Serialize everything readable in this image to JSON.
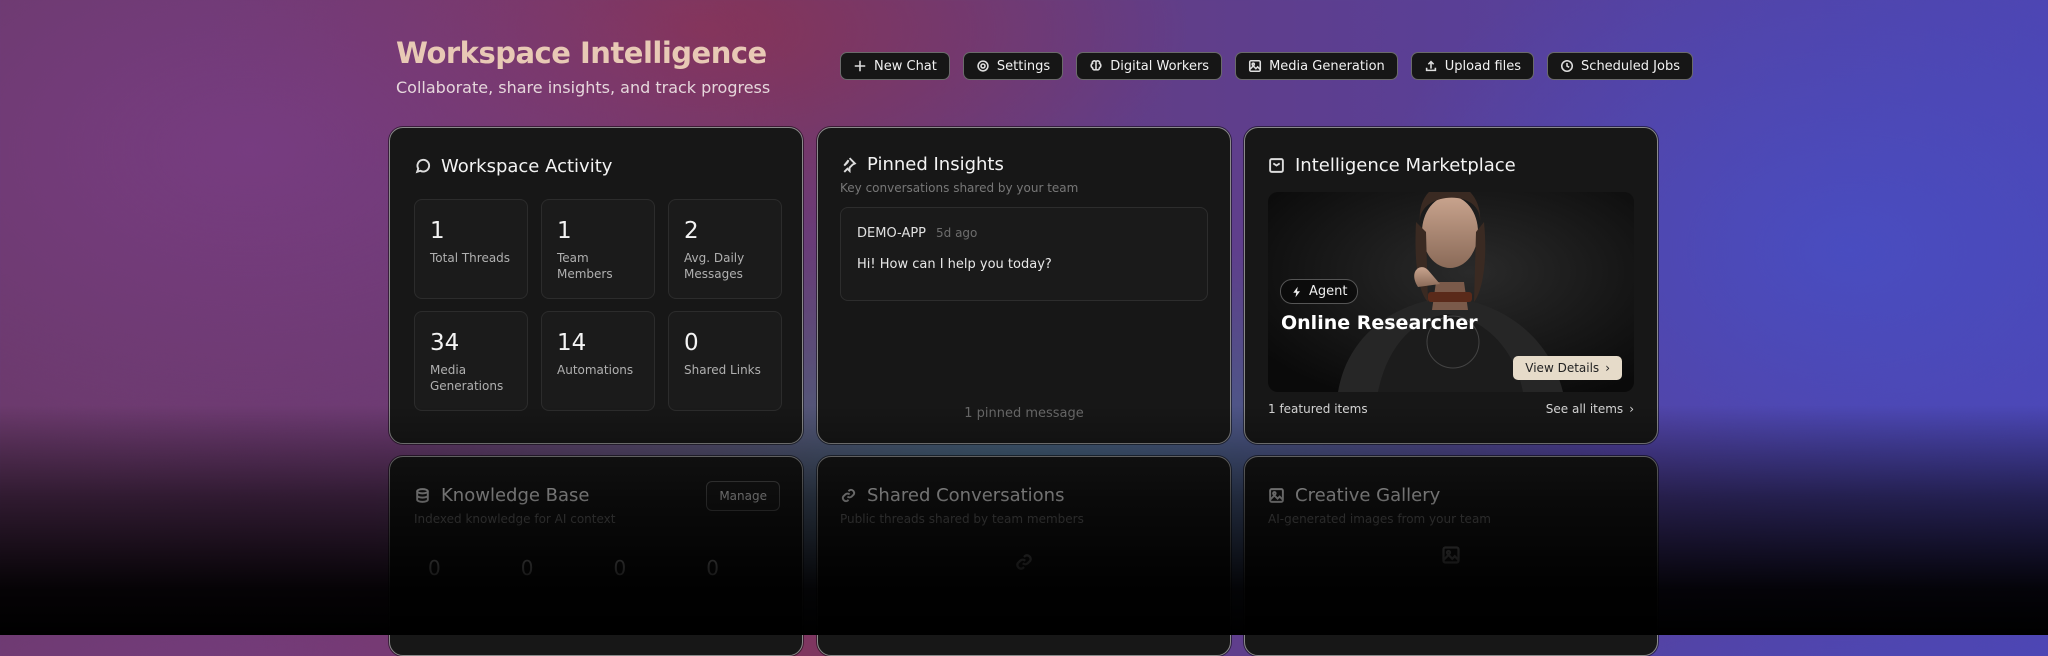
{
  "header": {
    "title": "Workspace Intelligence",
    "subtitle": "Collaborate, share insights, and track progress"
  },
  "toolbar": [
    {
      "label": "New Chat",
      "icon": "plus-icon"
    },
    {
      "label": "Settings",
      "icon": "gear-icon"
    },
    {
      "label": "Digital Workers",
      "icon": "brain-icon"
    },
    {
      "label": "Media Generation",
      "icon": "image-icon"
    },
    {
      "label": "Upload files",
      "icon": "upload-icon"
    },
    {
      "label": "Scheduled Jobs",
      "icon": "clock-icon"
    }
  ],
  "activity": {
    "title": "Workspace Activity",
    "stats": [
      {
        "value": "1",
        "label": "Total Threads"
      },
      {
        "value": "1",
        "label": "Team Members"
      },
      {
        "value": "2",
        "label": "Avg. Daily Messages"
      },
      {
        "value": "34",
        "label": "Media Generations"
      },
      {
        "value": "14",
        "label": "Automations"
      },
      {
        "value": "0",
        "label": "Shared Links"
      }
    ]
  },
  "pinned": {
    "title": "Pinned Insights",
    "subtitle": "Key conversations shared by your team",
    "item": {
      "app": "DEMO-APP",
      "time": "5d ago",
      "message": "Hi! How can I help you today?"
    },
    "footer": "1 pinned message"
  },
  "marketplace": {
    "title": "Intelligence Marketplace",
    "badge": "Agent",
    "agent_name": "Online Researcher",
    "view_details": "View Details",
    "featured": "1 featured items",
    "see_all": "See all items"
  },
  "knowledge": {
    "title": "Knowledge Base",
    "subtitle": "Indexed knowledge for AI context",
    "manage": "Manage",
    "values": [
      "0",
      "0",
      "0",
      "0"
    ]
  },
  "shared": {
    "title": "Shared Conversations",
    "subtitle": "Public threads shared by team members"
  },
  "gallery": {
    "title": "Creative Gallery",
    "subtitle": "AI-generated images from your team"
  }
}
